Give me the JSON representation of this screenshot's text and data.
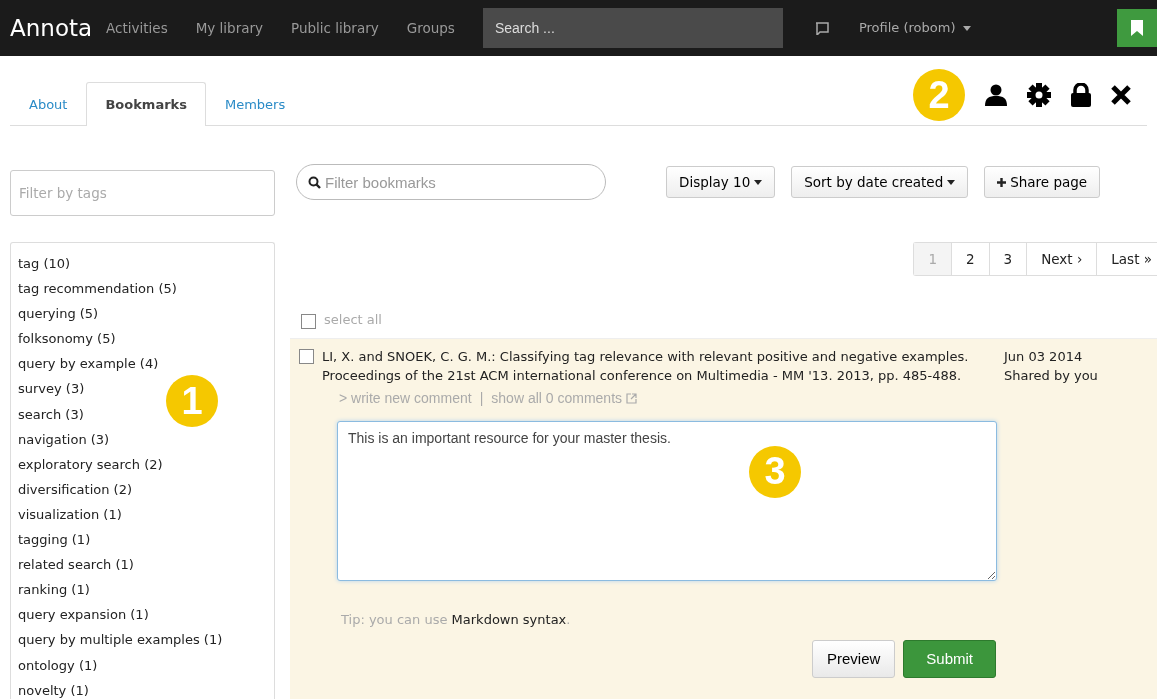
{
  "navbar": {
    "brand": "Annota",
    "links": [
      {
        "label": "Activities"
      },
      {
        "label": "My library"
      },
      {
        "label": "Public library"
      },
      {
        "label": "Groups"
      }
    ],
    "search": {
      "placeholder": "Search ..."
    },
    "profile": "Profile (robom)"
  },
  "tabs": [
    {
      "label": "About",
      "selected": false
    },
    {
      "label": "Bookmarks",
      "selected": true
    },
    {
      "label": "Members",
      "selected": false
    }
  ],
  "callouts": [
    "1",
    "2",
    "3"
  ],
  "tag_filter": {
    "placeholder": "Filter by tags"
  },
  "tags": [
    "tag (10)",
    "tag recommendation (5)",
    "querying (5)",
    "folksonomy (5)",
    "query by example (4)",
    "survey (3)",
    "search (3)",
    "navigation (3)",
    "exploratory search (2)",
    "diversification (2)",
    "visualization (1)",
    "tagging (1)",
    "related search (1)",
    "ranking (1)",
    "query expansion (1)",
    "query by multiple examples (1)",
    "ontology (1)",
    "novelty (1)"
  ],
  "bookmark_filter": {
    "placeholder": "Filter bookmarks"
  },
  "toolbar": {
    "display": "Display 10",
    "sort": "Sort by date created",
    "share": "Share page"
  },
  "pagination": [
    {
      "label": "1",
      "selected": true
    },
    {
      "label": "2",
      "selected": false
    },
    {
      "label": "3",
      "selected": false
    },
    {
      "label": "Next ›",
      "selected": false
    },
    {
      "label": "Last »",
      "selected": false
    }
  ],
  "select_all": {
    "label": "select all",
    "checked": false
  },
  "bookmark": {
    "checked": false,
    "citation": "LI, X. and SNOEK, C. G. M.: Classifying tag relevance with relevant positive and negative examples. Proceedings of the 21st ACM international conference on Multimedia - MM '13. 2013, pp. 485-488.",
    "date": "Jun 03 2014",
    "shared": "Shared by you",
    "write_comment": "> write new comment",
    "separator": "|",
    "show_comments": "show all 0 comments",
    "comment": "This is an important resource for your master thesis.",
    "tip": "Tip: you can use **Markdown syntax**.",
    "preview": "Preview",
    "submit": "Submit"
  }
}
